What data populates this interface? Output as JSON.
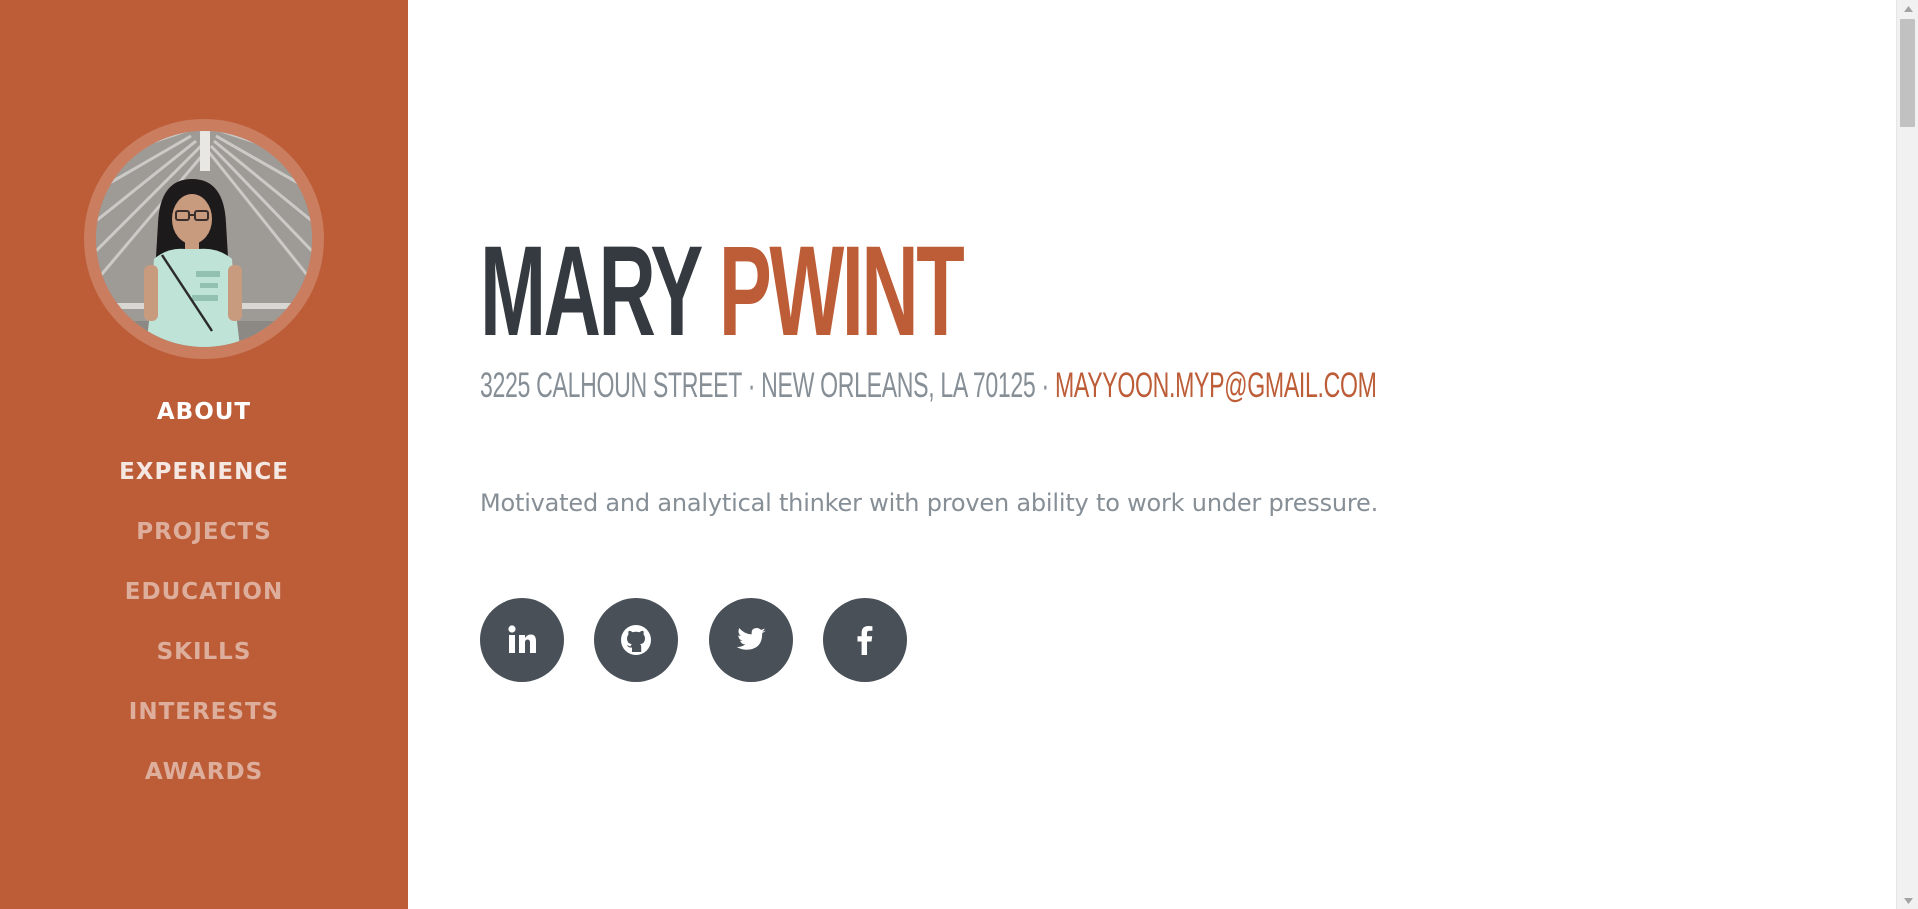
{
  "profile": {
    "avatar_alt": "Profile photo"
  },
  "nav": {
    "items": [
      {
        "label": "ABOUT",
        "state": "active"
      },
      {
        "label": "EXPERIENCE",
        "state": "hover"
      },
      {
        "label": "PROJECTS",
        "state": "normal"
      },
      {
        "label": "EDUCATION",
        "state": "normal"
      },
      {
        "label": "SKILLS",
        "state": "normal"
      },
      {
        "label": "INTERESTS",
        "state": "normal"
      },
      {
        "label": "AWARDS",
        "state": "normal"
      }
    ]
  },
  "header": {
    "first_name": "MARY",
    "last_name": "PWINT",
    "address": "3225 CALHOUN STREET · NEW ORLEANS, LA 70125 · ",
    "email": "MAYYOON.MYP@GMAIL.COM"
  },
  "about": {
    "lead": "Motivated and analytical thinker with proven ability to work under pressure."
  },
  "social": [
    {
      "icon": "linkedin-icon"
    },
    {
      "icon": "github-icon"
    },
    {
      "icon": "twitter-icon"
    },
    {
      "icon": "facebook-icon"
    }
  ],
  "colors": {
    "primary": "#bd5d38",
    "dark": "#343a40",
    "muted": "#868e96",
    "social_bg": "#495057"
  }
}
